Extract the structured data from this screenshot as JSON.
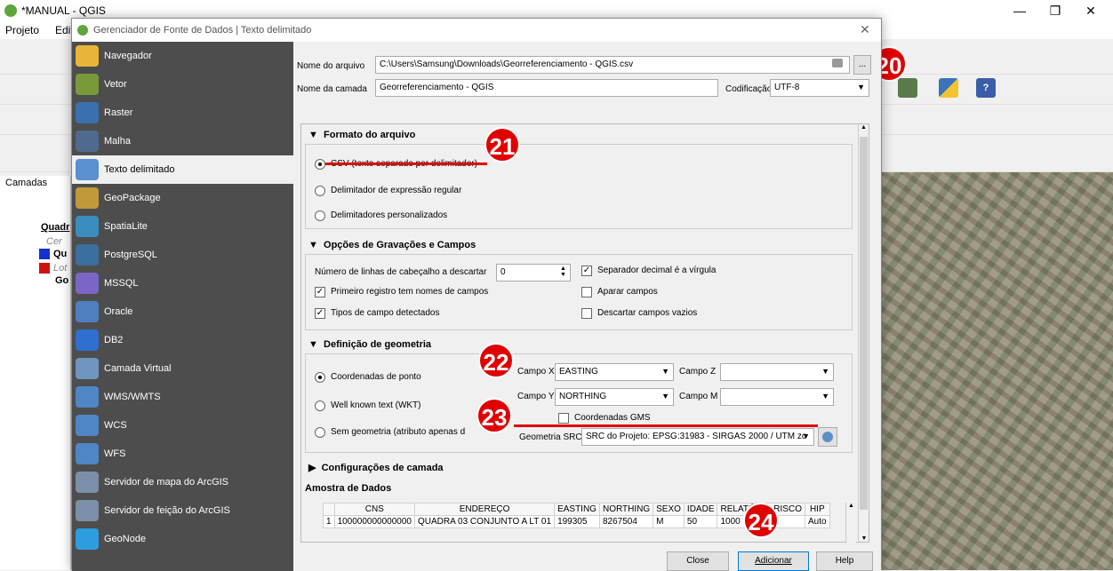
{
  "app": {
    "title": "*MANUAL - QGIS",
    "menu": [
      "Projeto",
      "Edit"
    ],
    "layers_label": "Camadas",
    "layers": [
      "Quadr",
      "Cer",
      "Qu",
      "Lot",
      "Go"
    ]
  },
  "dialog": {
    "title": "Gerenciador de Fonte de Dados | Texto delimitado",
    "sidebar": [
      {
        "label": "Navegador",
        "icon": "folder-icon"
      },
      {
        "label": "Vetor",
        "icon": "vector-icon"
      },
      {
        "label": "Raster",
        "icon": "raster-icon"
      },
      {
        "label": "Malha",
        "icon": "mesh-icon"
      },
      {
        "label": "Texto delimitado",
        "icon": "delimited-text-icon"
      },
      {
        "label": "GeoPackage",
        "icon": "geopackage-icon"
      },
      {
        "label": "SpatiaLite",
        "icon": "spatialite-icon"
      },
      {
        "label": "PostgreSQL",
        "icon": "postgresql-icon"
      },
      {
        "label": "MSSQL",
        "icon": "mssql-icon"
      },
      {
        "label": "Oracle",
        "icon": "oracle-icon"
      },
      {
        "label": "DB2",
        "icon": "db2-icon"
      },
      {
        "label": "Camada Virtual",
        "icon": "virtual-layer-icon"
      },
      {
        "label": "WMS/WMTS",
        "icon": "wms-icon"
      },
      {
        "label": "WCS",
        "icon": "wcs-icon"
      },
      {
        "label": "WFS",
        "icon": "wfs-icon"
      },
      {
        "label": "Servidor de mapa do ArcGIS",
        "icon": "arcgis-map-icon"
      },
      {
        "label": "Servidor de feição do ArcGIS",
        "icon": "arcgis-feature-icon"
      },
      {
        "label": "GeoNode",
        "icon": "geonode-icon"
      }
    ],
    "file_label": "Nome do arquivo",
    "file_value": "C:\\Users\\Samsung\\Downloads\\Georreferenciamento - QGIS.csv",
    "browse_label": "...",
    "layer_name_label": "Nome da camada",
    "layer_name_value": "Georreferenciamento - QGIS",
    "encoding_label": "Codificação",
    "encoding_value": "UTF-8",
    "file_format": {
      "header": "Formato do arquivo",
      "options": [
        "CSV (texto separado por delimitador)",
        "Delimitador de expressão regular",
        "Delimitadores personalizados"
      ]
    },
    "record_options": {
      "header": "Opções de Gravações e Campos",
      "skip_lines_label": "Número de linhas de cabeçalho a descartar",
      "skip_lines_value": "0",
      "first_record_label": "Primeiro registro tem nomes de campos",
      "detect_types_label": "Tipos de campo detectados",
      "decimal_comma_label": "Separador decimal é a vírgula",
      "trim_label": "Aparar campos",
      "discard_empty_label": "Descartar campos vazios"
    },
    "geometry": {
      "header": "Definição de geometria",
      "options": [
        "Coordenadas de ponto",
        "Well known text (WKT)",
        "Sem geometria (atributo apenas d"
      ],
      "x_label": "Campo X",
      "x_value": "EASTING",
      "y_label": "Campo Y",
      "y_value": "NORTHING",
      "z_label": "Campo Z",
      "z_value": "",
      "m_label": "Campo M",
      "m_value": "",
      "dms_label": "Coordenadas GMS",
      "crs_label": "Geometria SRC",
      "crs_value": "SRC do Projeto: EPSG:31983 - SIRGAS 2000 / UTM zc"
    },
    "layer_settings_header": "Configurações de camada",
    "sample_header": "Amostra de Dados",
    "sample": {
      "columns": [
        "",
        "CNS",
        "ENDEREÇO",
        "EASTING",
        "NORTHING",
        "SEXO",
        "IDADE",
        "RELATÓRIO RISCO",
        "HIP"
      ],
      "rows": [
        [
          "1",
          "100000000000000",
          "QUADRA 03 CONJUNTO A LT 01",
          "199305",
          "8267504",
          "M",
          "50",
          "1000",
          "Auto"
        ]
      ]
    },
    "buttons": {
      "close": "Close",
      "add": "Adicionar",
      "help": "Help"
    }
  },
  "annotations": [
    "20",
    "21",
    "22",
    "23",
    "24"
  ],
  "colors": {
    "annotation": "#e00000",
    "sidebar": "#4d4d4d"
  }
}
